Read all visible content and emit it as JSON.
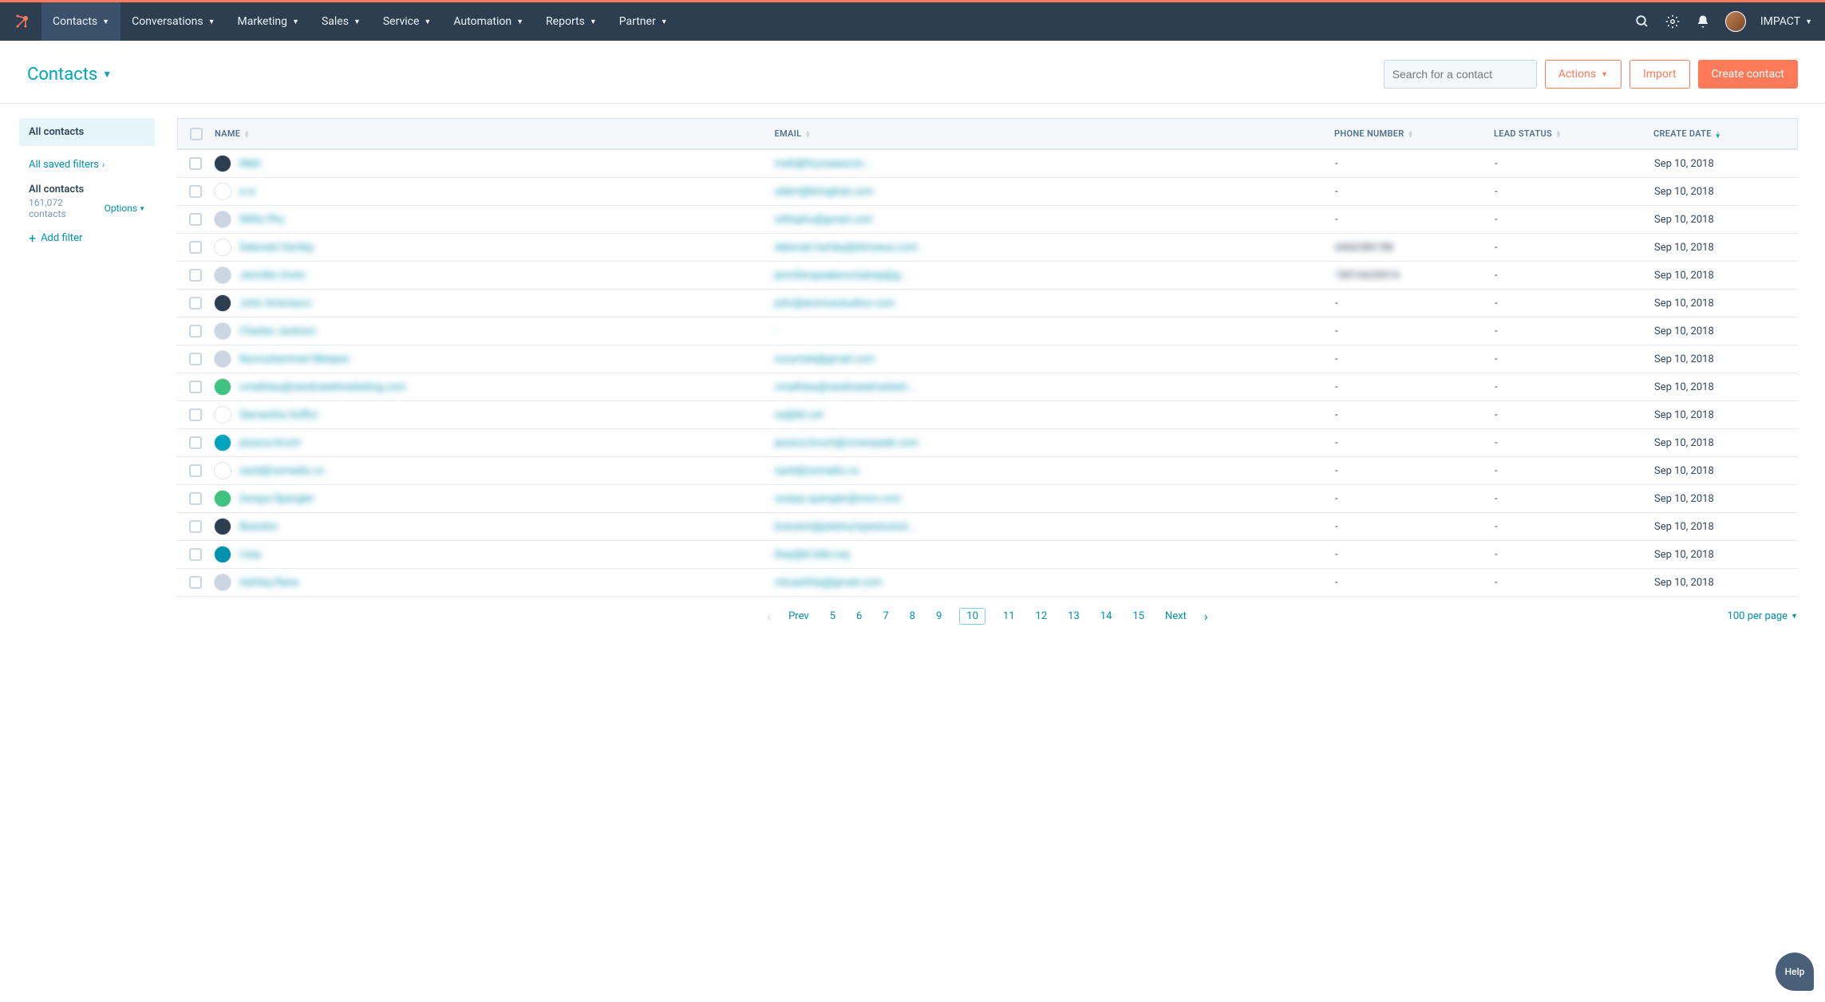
{
  "nav": {
    "items": [
      "Contacts",
      "Conversations",
      "Marketing",
      "Sales",
      "Service",
      "Automation",
      "Reports",
      "Partner"
    ],
    "account": "IMPACT"
  },
  "page": {
    "title": "Contacts",
    "search_placeholder": "Search for a contact",
    "actions_btn": "Actions",
    "import_btn": "Import",
    "create_btn": "Create contact"
  },
  "sidebar": {
    "all_contacts": "All contacts",
    "saved_filters": "All saved filters",
    "section_title": "All contacts",
    "count_text": "161,072 contacts",
    "options": "Options",
    "add_filter": "Add filter"
  },
  "table": {
    "headers": [
      "NAME",
      "EMAIL",
      "PHONE NUMBER",
      "LEAD STATUS",
      "CREATE DATE"
    ],
    "rows": [
      {
        "name": "Matt",
        "email": "matt@fourseasons...",
        "phone": "-",
        "lead": "-",
        "date": "Sep 10, 2018",
        "color": "#2d3e50"
      },
      {
        "name": "a w",
        "email": "adam@bringhub.com",
        "phone": "-",
        "lead": "-",
        "date": "Sep 10, 2018",
        "color": "#fff"
      },
      {
        "name": "Willis Phu",
        "email": "willisphu@gmail.com",
        "phone": "-",
        "lead": "-",
        "date": "Sep 10, 2018",
        "color": "#cbd6e2"
      },
      {
        "name": "Deborah Hartley",
        "email": "deborah.hartley@dmnews.com",
        "phone": "6466386188",
        "lead": "-",
        "date": "Sep 10, 2018",
        "color": "#fff"
      },
      {
        "name": "Jennifer Urwin",
        "email": "jenniferspeakersclubrep@g...",
        "phone": "18016620014",
        "lead": "-",
        "date": "Sep 10, 2018",
        "color": "#cbd6e2"
      },
      {
        "name": "John Antonacci",
        "email": "john@animusstudios.com",
        "phone": "-",
        "lead": "-",
        "date": "Sep 10, 2018",
        "color": "#2d3e50"
      },
      {
        "name": "Charles Jackson",
        "email": "-",
        "phone": "-",
        "lead": "-",
        "date": "Sep 10, 2018",
        "color": "#cbd6e2"
      },
      {
        "name": "Nurmuhammet Melayev",
        "email": "nurymele@gmail.com",
        "phone": "-",
        "lead": "-",
        "date": "Sep 10, 2018",
        "color": "#cbd6e2"
      },
      {
        "name": "cmathieu@newbreedmarketing.com",
        "email": "cmathieu@newbreedmarketi...",
        "phone": "-",
        "lead": "-",
        "date": "Sep 10, 2018",
        "color": "#3fc380"
      },
      {
        "name": "Samantha Soffici",
        "email": "ss@ibt.onl",
        "phone": "-",
        "lead": "-",
        "date": "Sep 10, 2018",
        "color": "#fff"
      },
      {
        "name": "jessica bruch",
        "email": "jessica.bruch@crownpeak.com",
        "phone": "-",
        "lead": "-",
        "date": "Sep 10, 2018",
        "color": "#00a4bd"
      },
      {
        "name": "zack@nomadix.co",
        "email": "zack@nomadix.co",
        "phone": "-",
        "lead": "-",
        "date": "Sep 10, 2018",
        "color": "#fff"
      },
      {
        "name": "Soraya Spangler",
        "email": "soraya.spangler@moo.com",
        "phone": "-",
        "lead": "-",
        "date": "Sep 10, 2018",
        "color": "#3fc380"
      },
      {
        "name": "Brandon",
        "email": "brandon@platinumpestsoluti...",
        "phone": "-",
        "lead": "-",
        "date": "Sep 10, 2018",
        "color": "#2d3e50"
      },
      {
        "name": "Lhey",
        "email": "lhey@kt.bbb.org",
        "phone": "-",
        "lead": "-",
        "date": "Sep 10, 2018",
        "color": "#0091ae"
      },
      {
        "name": "Ashfaq Rana",
        "email": "mtcashfaq@gmail.com",
        "phone": "-",
        "lead": "-",
        "date": "Sep 10, 2018",
        "color": "#cbd6e2"
      }
    ]
  },
  "pager": {
    "prev": "Prev",
    "pages": [
      "5",
      "6",
      "7",
      "8",
      "9",
      "10",
      "11",
      "12",
      "13",
      "14",
      "15"
    ],
    "current": "10",
    "next": "Next",
    "per_page": "100 per page"
  },
  "help": "Help"
}
